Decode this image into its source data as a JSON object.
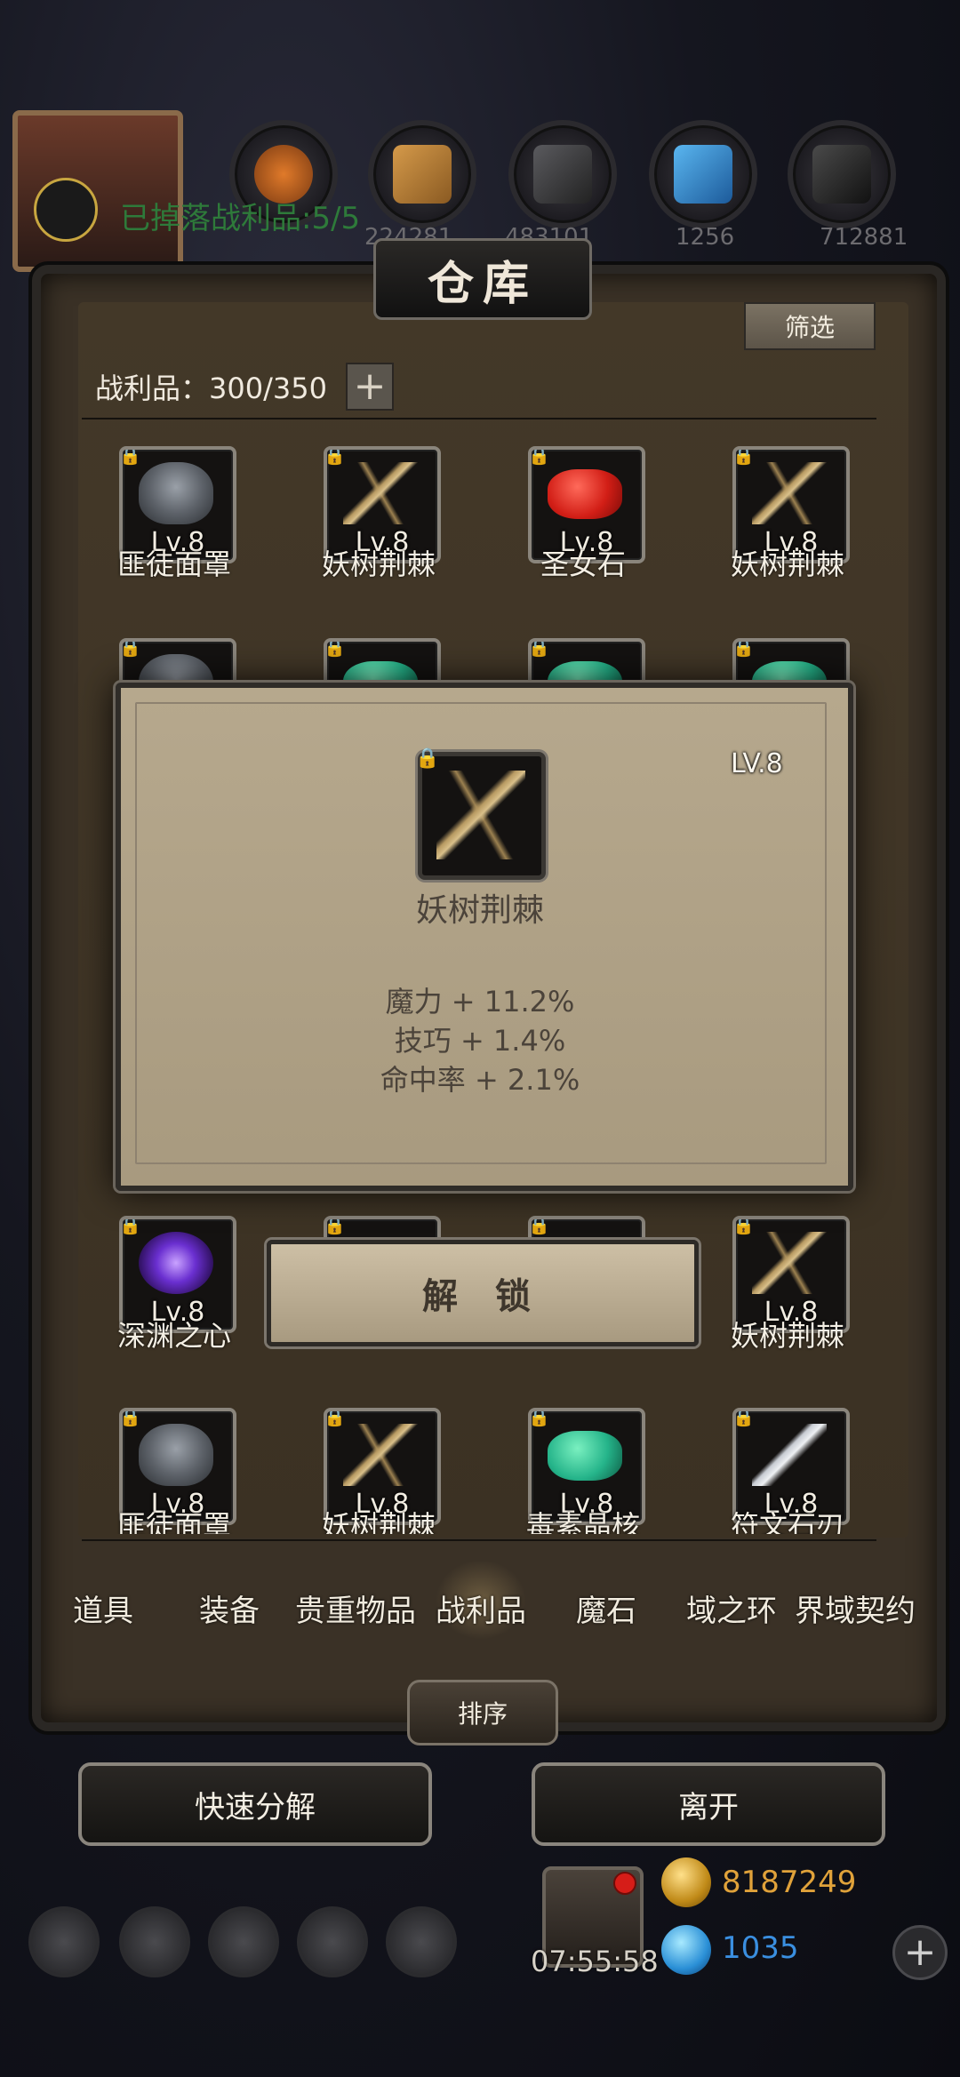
{
  "top_resources": [
    {
      "icon": "wood-icon"
    },
    {
      "icon": "plank-icon"
    },
    {
      "icon": "iron-icon"
    },
    {
      "icon": "crystal-icon"
    },
    {
      "icon": "ore-icon"
    }
  ],
  "top_numbers": [
    "224281",
    "483101",
    "1256",
    "712881"
  ],
  "drop_status": "已掉落战利品:5/5",
  "warehouse": {
    "title": "仓库",
    "filter_label": "筛选",
    "loot_label": "战利品：300/350",
    "plus": "+"
  },
  "items": {
    "row1": [
      {
        "lv": "Lv.8",
        "name": "匪徒面罩",
        "art": "mask-icon"
      },
      {
        "lv": "Lv.8",
        "name": "妖树荆棘",
        "art": "thorn-branch-icon"
      },
      {
        "lv": "Lv.8",
        "name": "圣女石",
        "art": "red-stone-icon"
      },
      {
        "lv": "Lv.8",
        "name": "妖树荆棘",
        "art": "thorn-branch-icon"
      }
    ],
    "row4": [
      {
        "lv": "",
        "name": "深渊之心",
        "art": "abyss-heart-icon"
      },
      {
        "lv": "Lv.8",
        "name": "妖树荆棘",
        "art": "thorn-branch-icon"
      }
    ],
    "row5": [
      {
        "lv": "Lv.8",
        "name": "匪徒面罩",
        "art": "mask-icon"
      },
      {
        "lv": "Lv.8",
        "name": "妖树荆棘",
        "art": "thorn-branch-icon"
      },
      {
        "lv": "Lv.8",
        "name": "毒素晶核",
        "art": "green-gem-icon"
      },
      {
        "lv": "Lv.8",
        "name": "符文石刃",
        "art": "rune-blade-icon"
      }
    ],
    "row4_first_lv": "Lv.8"
  },
  "popup": {
    "level": "LV.8",
    "name": "妖树荆棘",
    "stats": [
      "魔力 + 11.2%",
      "技巧 + 1.4%",
      "命中率 + 2.1%"
    ]
  },
  "unlock_label": "解 锁",
  "tabs": [
    "道具",
    "装备",
    "贵重物品",
    "战利品",
    "魔石",
    "域之环",
    "界域契约"
  ],
  "active_tab": "战利品",
  "sort_label": "排序",
  "quick_decompose_label": "快速分解",
  "leave_label": "离开",
  "bottom": {
    "timer": "07:55:58",
    "gold": "8187249",
    "gems": "1035",
    "plus": "+"
  },
  "colors": {
    "gold_text": "#e0a23a",
    "gem_text": "#3a8fe0"
  }
}
